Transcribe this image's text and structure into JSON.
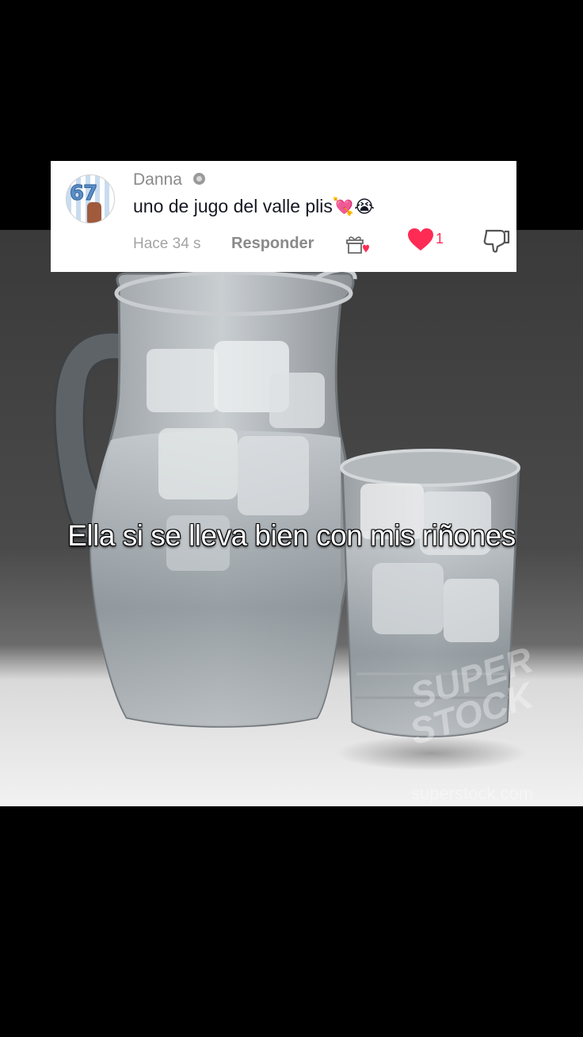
{
  "comment": {
    "username": "Danna",
    "avatar_text": "67",
    "text": "uno de jugo del valle plis",
    "emojis": "💘😭",
    "time": "Hace 34 s",
    "reply_label": "Responder",
    "like_count": "1",
    "like_color": "#fe2c55"
  },
  "video": {
    "caption": "Ella si se lleva bien con mis riñones",
    "watermark": "superstock.com"
  },
  "icons": {
    "verified": "verified-badge-icon",
    "gift": "gift-heart-icon",
    "like": "heart-icon",
    "dislike": "thumbs-down-icon"
  }
}
